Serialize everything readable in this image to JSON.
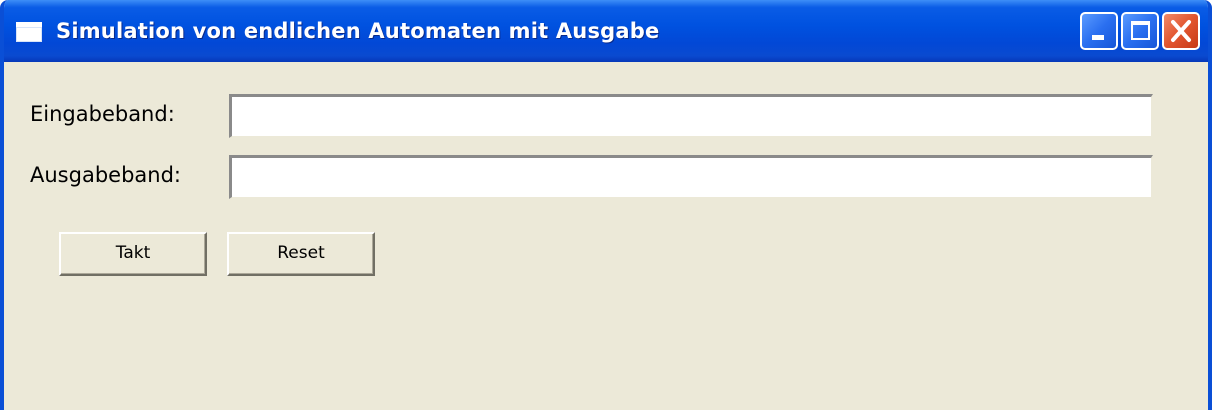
{
  "window": {
    "title": "Simulation von endlichen Automaten mit Ausgabe",
    "title_icon": "window-app-icon",
    "controls": {
      "minimize_icon": "minimize-icon",
      "maximize_icon": "maximize-icon",
      "close_icon": "close-icon"
    }
  },
  "form": {
    "input_tape_label": "Eingabeband:",
    "input_tape_value": "",
    "output_tape_label": "Ausgabeband:",
    "output_tape_value": ""
  },
  "buttons": {
    "takt_label": "Takt",
    "reset_label": "Reset"
  },
  "colors": {
    "titlebar": "#0052e0",
    "window_body": "#ece9d8",
    "close_button": "#e2552e"
  }
}
